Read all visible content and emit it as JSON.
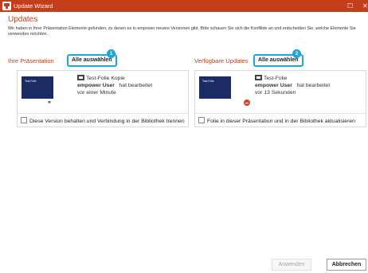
{
  "window": {
    "title": "Update Wizard",
    "maximize_glyph": "☐",
    "close_glyph": "✕"
  },
  "heading": "Updates",
  "intro": "Wir haben in Ihrer Präsentation Elemente gefunden, zu denen es in empower neuere Versionen gibt. Bitte schauen Sie sich die Konflikte an und entscheiden Sie, welche Elemente Sie verwenden möchten.",
  "left": {
    "label": "Ihre Präsentation",
    "select_all": "Alle auswählen",
    "badge": "1",
    "card": {
      "thumb_title": "Test-Folie",
      "slide_name": "Test-Folie Kopie",
      "user": "empower User",
      "action": "hat bearbeitet",
      "time": "vor einer Minute",
      "status_icon": "link-icon",
      "checkbox_label": "Diese Version behalten und Verbindung in der Bibliothek trennen"
    }
  },
  "right": {
    "label": "Verfügbare Updates",
    "select_all": "Alle auswählen",
    "badge": "2",
    "card": {
      "thumb_title": "Test-Folie",
      "slide_name": "Test-Folie",
      "user": "empower User",
      "action": "hat bearbeitet",
      "time": "vor 13 Sekunden",
      "status_icon": "red-minus-icon",
      "checkbox_label": "Folie in dieser Präsentation und in der Bibliothek aktualisieren"
    }
  },
  "footer": {
    "apply": "Anwenden",
    "cancel": "Abbrechen"
  },
  "colors": {
    "accent": "#c43e1c",
    "highlight": "#1ea6d6",
    "thumb_bg": "#1d2b64"
  }
}
